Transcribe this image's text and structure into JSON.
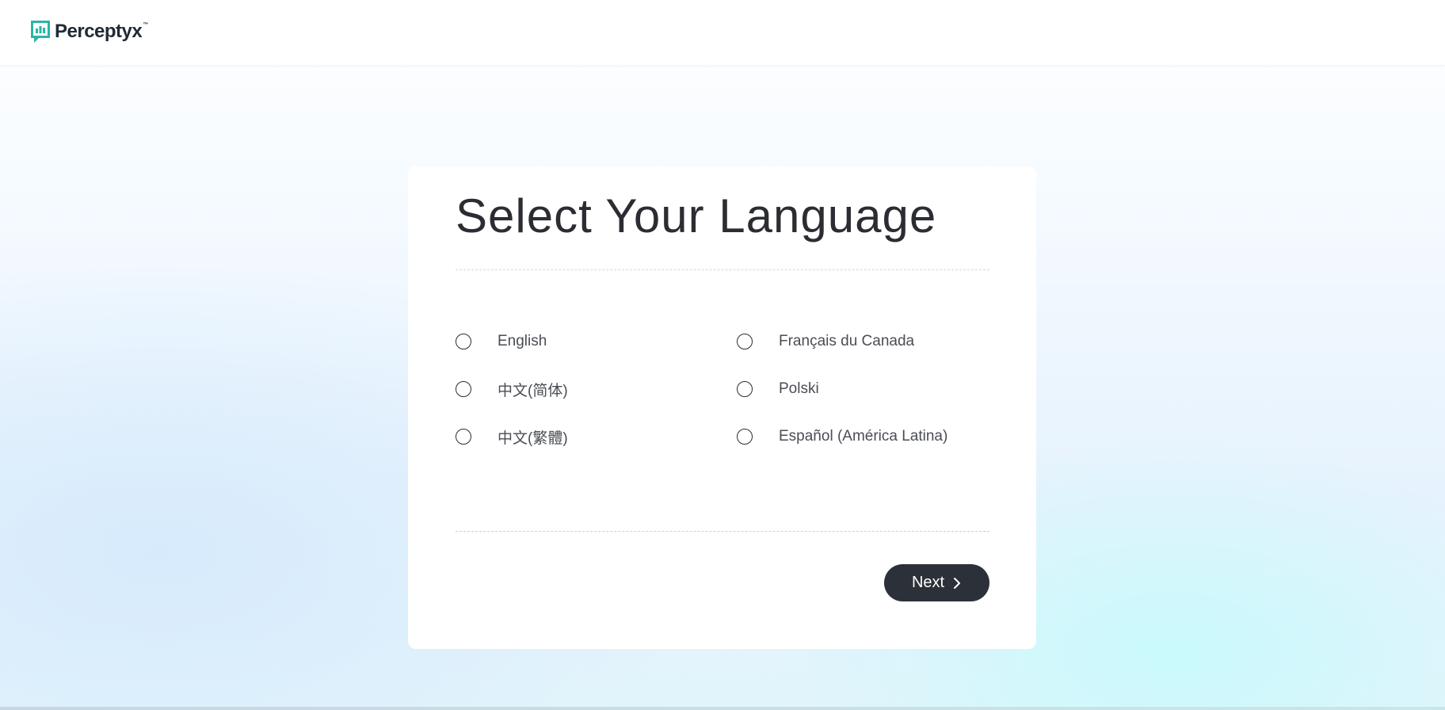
{
  "header": {
    "logo_text": "Perceptyx",
    "logo_tm": "™",
    "logo_icon": "chat-bar-chart-icon",
    "brand_color": "#2bb5a8"
  },
  "page": {
    "title": "Select Your Language"
  },
  "languages": [
    {
      "label": "English",
      "selected": false
    },
    {
      "label": "Français du Canada",
      "selected": false
    },
    {
      "label": "中文(简体)",
      "selected": false
    },
    {
      "label": "Polski",
      "selected": false
    },
    {
      "label": "中文(繁體)",
      "selected": false
    },
    {
      "label": "Español (América Latina)",
      "selected": false
    }
  ],
  "actions": {
    "next_label": "Next",
    "next_icon": "chevron-right-icon",
    "button_color": "#2c3038"
  }
}
